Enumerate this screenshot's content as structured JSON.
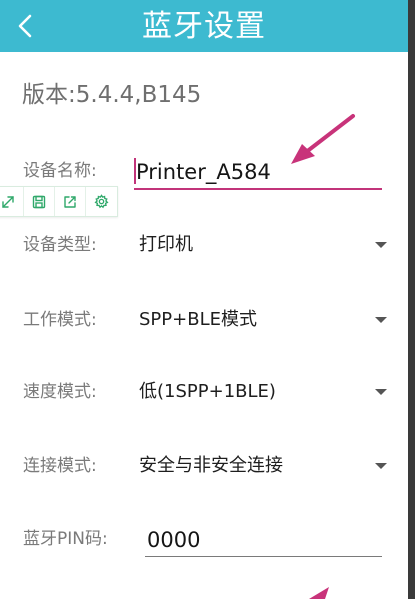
{
  "header": {
    "title": "蓝牙设置",
    "back_icon": "chevron-left-icon",
    "bg_color": "#3dbad0"
  },
  "version_label": "版本:5.4.4,B145",
  "form": {
    "device_name": {
      "label": "设备名称:",
      "value": "Printer_A584"
    },
    "device_type": {
      "label": "设备类型:",
      "value": "打印机"
    },
    "work_mode": {
      "label": "工作模式:",
      "value": "SPP+BLE模式"
    },
    "speed_mode": {
      "label": "速度模式:",
      "value": "低(1SPP+1BLE)"
    },
    "connect_mode": {
      "label": "连接模式:",
      "value": "安全与非安全连接"
    },
    "bt_pin": {
      "label": "蓝牙PIN码:",
      "value": "0000"
    }
  },
  "floating_toolbar": {
    "icons": [
      "expand-icon",
      "save-icon",
      "share-icon",
      "settings-icon"
    ],
    "icon_color": "#2fa86a"
  },
  "annotation": {
    "arrow_color": "#c8337a"
  }
}
